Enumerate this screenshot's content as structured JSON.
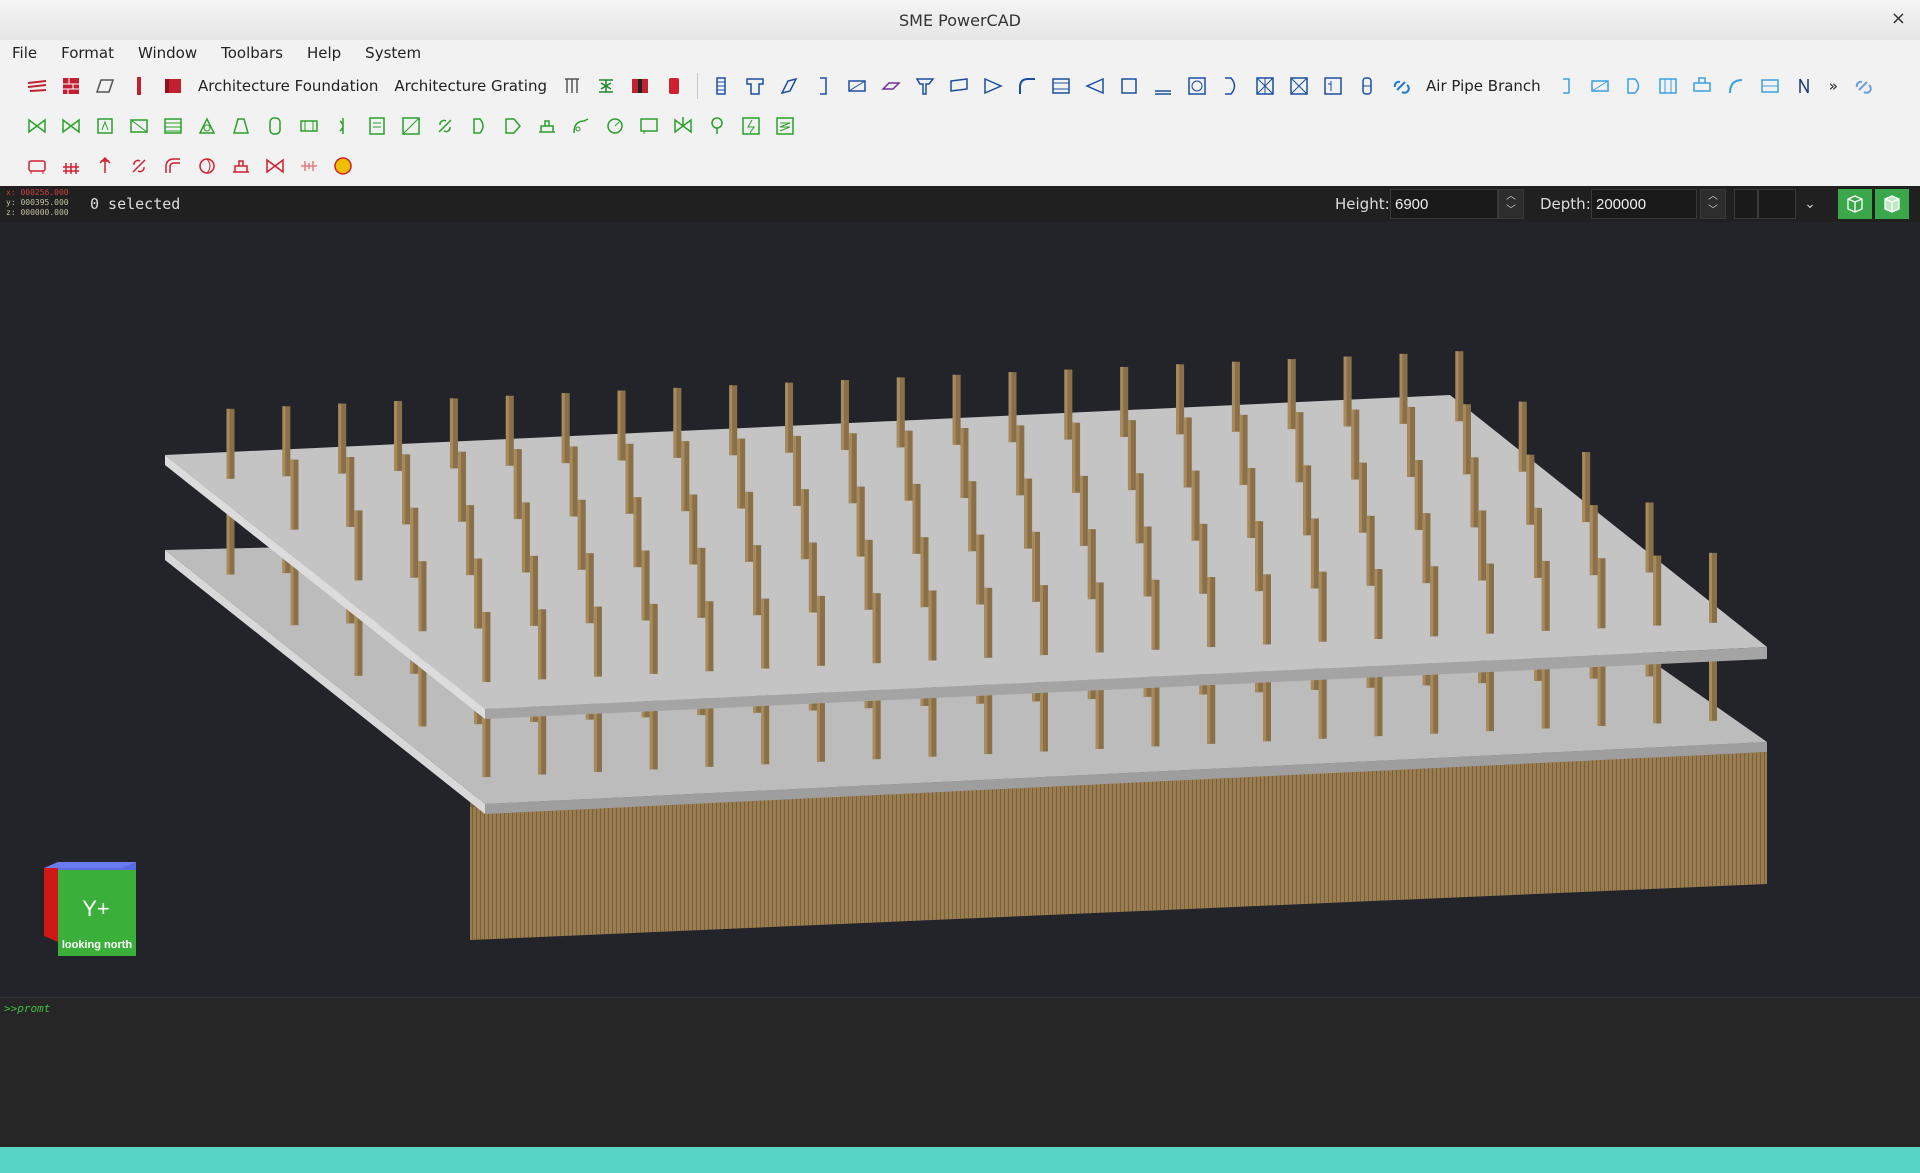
{
  "window": {
    "title": "SME PowerCAD",
    "close_icon": "close-icon"
  },
  "menu": [
    "File",
    "Format",
    "Window",
    "Toolbars",
    "Help",
    "System"
  ],
  "toolbar1": {
    "foundation_label": "Architecture Foundation",
    "grating_label": "Architecture Grating",
    "air_pipe_label": "Air Pipe Branch",
    "overflow": "»"
  },
  "status": {
    "coord_x": "x: 000256.000",
    "coord_y": "y: 000395.000",
    "coord_z": "z: 000000.000",
    "selected": "0 selected",
    "height_label": "Height:",
    "height_value": "6900",
    "depth_label": "Depth:",
    "depth_value": "200000"
  },
  "navcube": {
    "face": "Y+",
    "caption": "looking north"
  },
  "console": {
    "prompt": ">>promt"
  },
  "colors": {
    "slab": "#bebebe",
    "column": "#8a7048",
    "accent_bottom": "#57d6c6",
    "green_icon": "#2aa02a",
    "blue_icon": "#1a4fa0",
    "red_icon": "#d02030"
  }
}
